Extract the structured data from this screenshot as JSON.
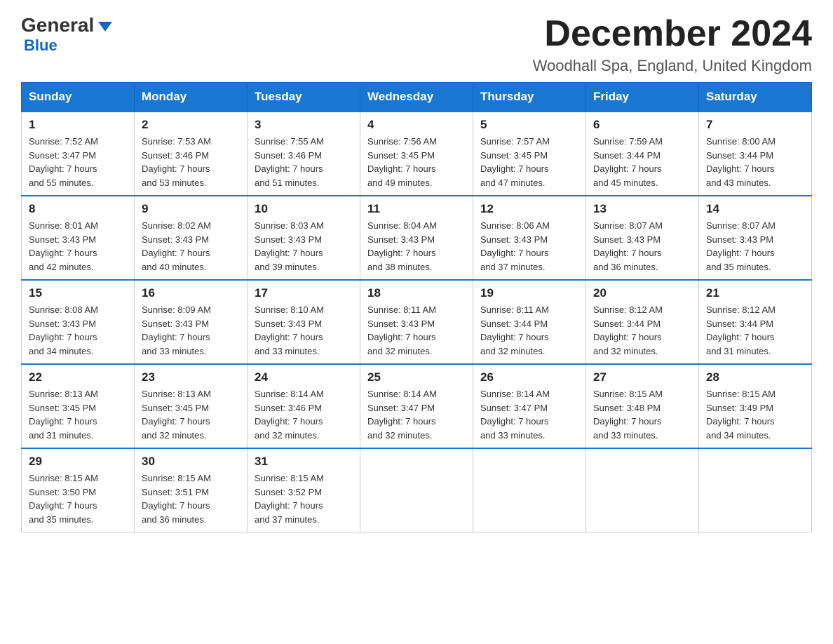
{
  "logo": {
    "general": "General",
    "triangle": "▶",
    "blue": "Blue"
  },
  "title": "December 2024",
  "location": "Woodhall Spa, England, United Kingdom",
  "days_header": [
    "Sunday",
    "Monday",
    "Tuesday",
    "Wednesday",
    "Thursday",
    "Friday",
    "Saturday"
  ],
  "weeks": [
    [
      {
        "day": "1",
        "info": "Sunrise: 7:52 AM\nSunset: 3:47 PM\nDaylight: 7 hours\nand 55 minutes."
      },
      {
        "day": "2",
        "info": "Sunrise: 7:53 AM\nSunset: 3:46 PM\nDaylight: 7 hours\nand 53 minutes."
      },
      {
        "day": "3",
        "info": "Sunrise: 7:55 AM\nSunset: 3:46 PM\nDaylight: 7 hours\nand 51 minutes."
      },
      {
        "day": "4",
        "info": "Sunrise: 7:56 AM\nSunset: 3:45 PM\nDaylight: 7 hours\nand 49 minutes."
      },
      {
        "day": "5",
        "info": "Sunrise: 7:57 AM\nSunset: 3:45 PM\nDaylight: 7 hours\nand 47 minutes."
      },
      {
        "day": "6",
        "info": "Sunrise: 7:59 AM\nSunset: 3:44 PM\nDaylight: 7 hours\nand 45 minutes."
      },
      {
        "day": "7",
        "info": "Sunrise: 8:00 AM\nSunset: 3:44 PM\nDaylight: 7 hours\nand 43 minutes."
      }
    ],
    [
      {
        "day": "8",
        "info": "Sunrise: 8:01 AM\nSunset: 3:43 PM\nDaylight: 7 hours\nand 42 minutes."
      },
      {
        "day": "9",
        "info": "Sunrise: 8:02 AM\nSunset: 3:43 PM\nDaylight: 7 hours\nand 40 minutes."
      },
      {
        "day": "10",
        "info": "Sunrise: 8:03 AM\nSunset: 3:43 PM\nDaylight: 7 hours\nand 39 minutes."
      },
      {
        "day": "11",
        "info": "Sunrise: 8:04 AM\nSunset: 3:43 PM\nDaylight: 7 hours\nand 38 minutes."
      },
      {
        "day": "12",
        "info": "Sunrise: 8:06 AM\nSunset: 3:43 PM\nDaylight: 7 hours\nand 37 minutes."
      },
      {
        "day": "13",
        "info": "Sunrise: 8:07 AM\nSunset: 3:43 PM\nDaylight: 7 hours\nand 36 minutes."
      },
      {
        "day": "14",
        "info": "Sunrise: 8:07 AM\nSunset: 3:43 PM\nDaylight: 7 hours\nand 35 minutes."
      }
    ],
    [
      {
        "day": "15",
        "info": "Sunrise: 8:08 AM\nSunset: 3:43 PM\nDaylight: 7 hours\nand 34 minutes."
      },
      {
        "day": "16",
        "info": "Sunrise: 8:09 AM\nSunset: 3:43 PM\nDaylight: 7 hours\nand 33 minutes."
      },
      {
        "day": "17",
        "info": "Sunrise: 8:10 AM\nSunset: 3:43 PM\nDaylight: 7 hours\nand 33 minutes."
      },
      {
        "day": "18",
        "info": "Sunrise: 8:11 AM\nSunset: 3:43 PM\nDaylight: 7 hours\nand 32 minutes."
      },
      {
        "day": "19",
        "info": "Sunrise: 8:11 AM\nSunset: 3:44 PM\nDaylight: 7 hours\nand 32 minutes."
      },
      {
        "day": "20",
        "info": "Sunrise: 8:12 AM\nSunset: 3:44 PM\nDaylight: 7 hours\nand 32 minutes."
      },
      {
        "day": "21",
        "info": "Sunrise: 8:12 AM\nSunset: 3:44 PM\nDaylight: 7 hours\nand 31 minutes."
      }
    ],
    [
      {
        "day": "22",
        "info": "Sunrise: 8:13 AM\nSunset: 3:45 PM\nDaylight: 7 hours\nand 31 minutes."
      },
      {
        "day": "23",
        "info": "Sunrise: 8:13 AM\nSunset: 3:45 PM\nDaylight: 7 hours\nand 32 minutes."
      },
      {
        "day": "24",
        "info": "Sunrise: 8:14 AM\nSunset: 3:46 PM\nDaylight: 7 hours\nand 32 minutes."
      },
      {
        "day": "25",
        "info": "Sunrise: 8:14 AM\nSunset: 3:47 PM\nDaylight: 7 hours\nand 32 minutes."
      },
      {
        "day": "26",
        "info": "Sunrise: 8:14 AM\nSunset: 3:47 PM\nDaylight: 7 hours\nand 33 minutes."
      },
      {
        "day": "27",
        "info": "Sunrise: 8:15 AM\nSunset: 3:48 PM\nDaylight: 7 hours\nand 33 minutes."
      },
      {
        "day": "28",
        "info": "Sunrise: 8:15 AM\nSunset: 3:49 PM\nDaylight: 7 hours\nand 34 minutes."
      }
    ],
    [
      {
        "day": "29",
        "info": "Sunrise: 8:15 AM\nSunset: 3:50 PM\nDaylight: 7 hours\nand 35 minutes."
      },
      {
        "day": "30",
        "info": "Sunrise: 8:15 AM\nSunset: 3:51 PM\nDaylight: 7 hours\nand 36 minutes."
      },
      {
        "day": "31",
        "info": "Sunrise: 8:15 AM\nSunset: 3:52 PM\nDaylight: 7 hours\nand 37 minutes."
      },
      null,
      null,
      null,
      null
    ]
  ]
}
